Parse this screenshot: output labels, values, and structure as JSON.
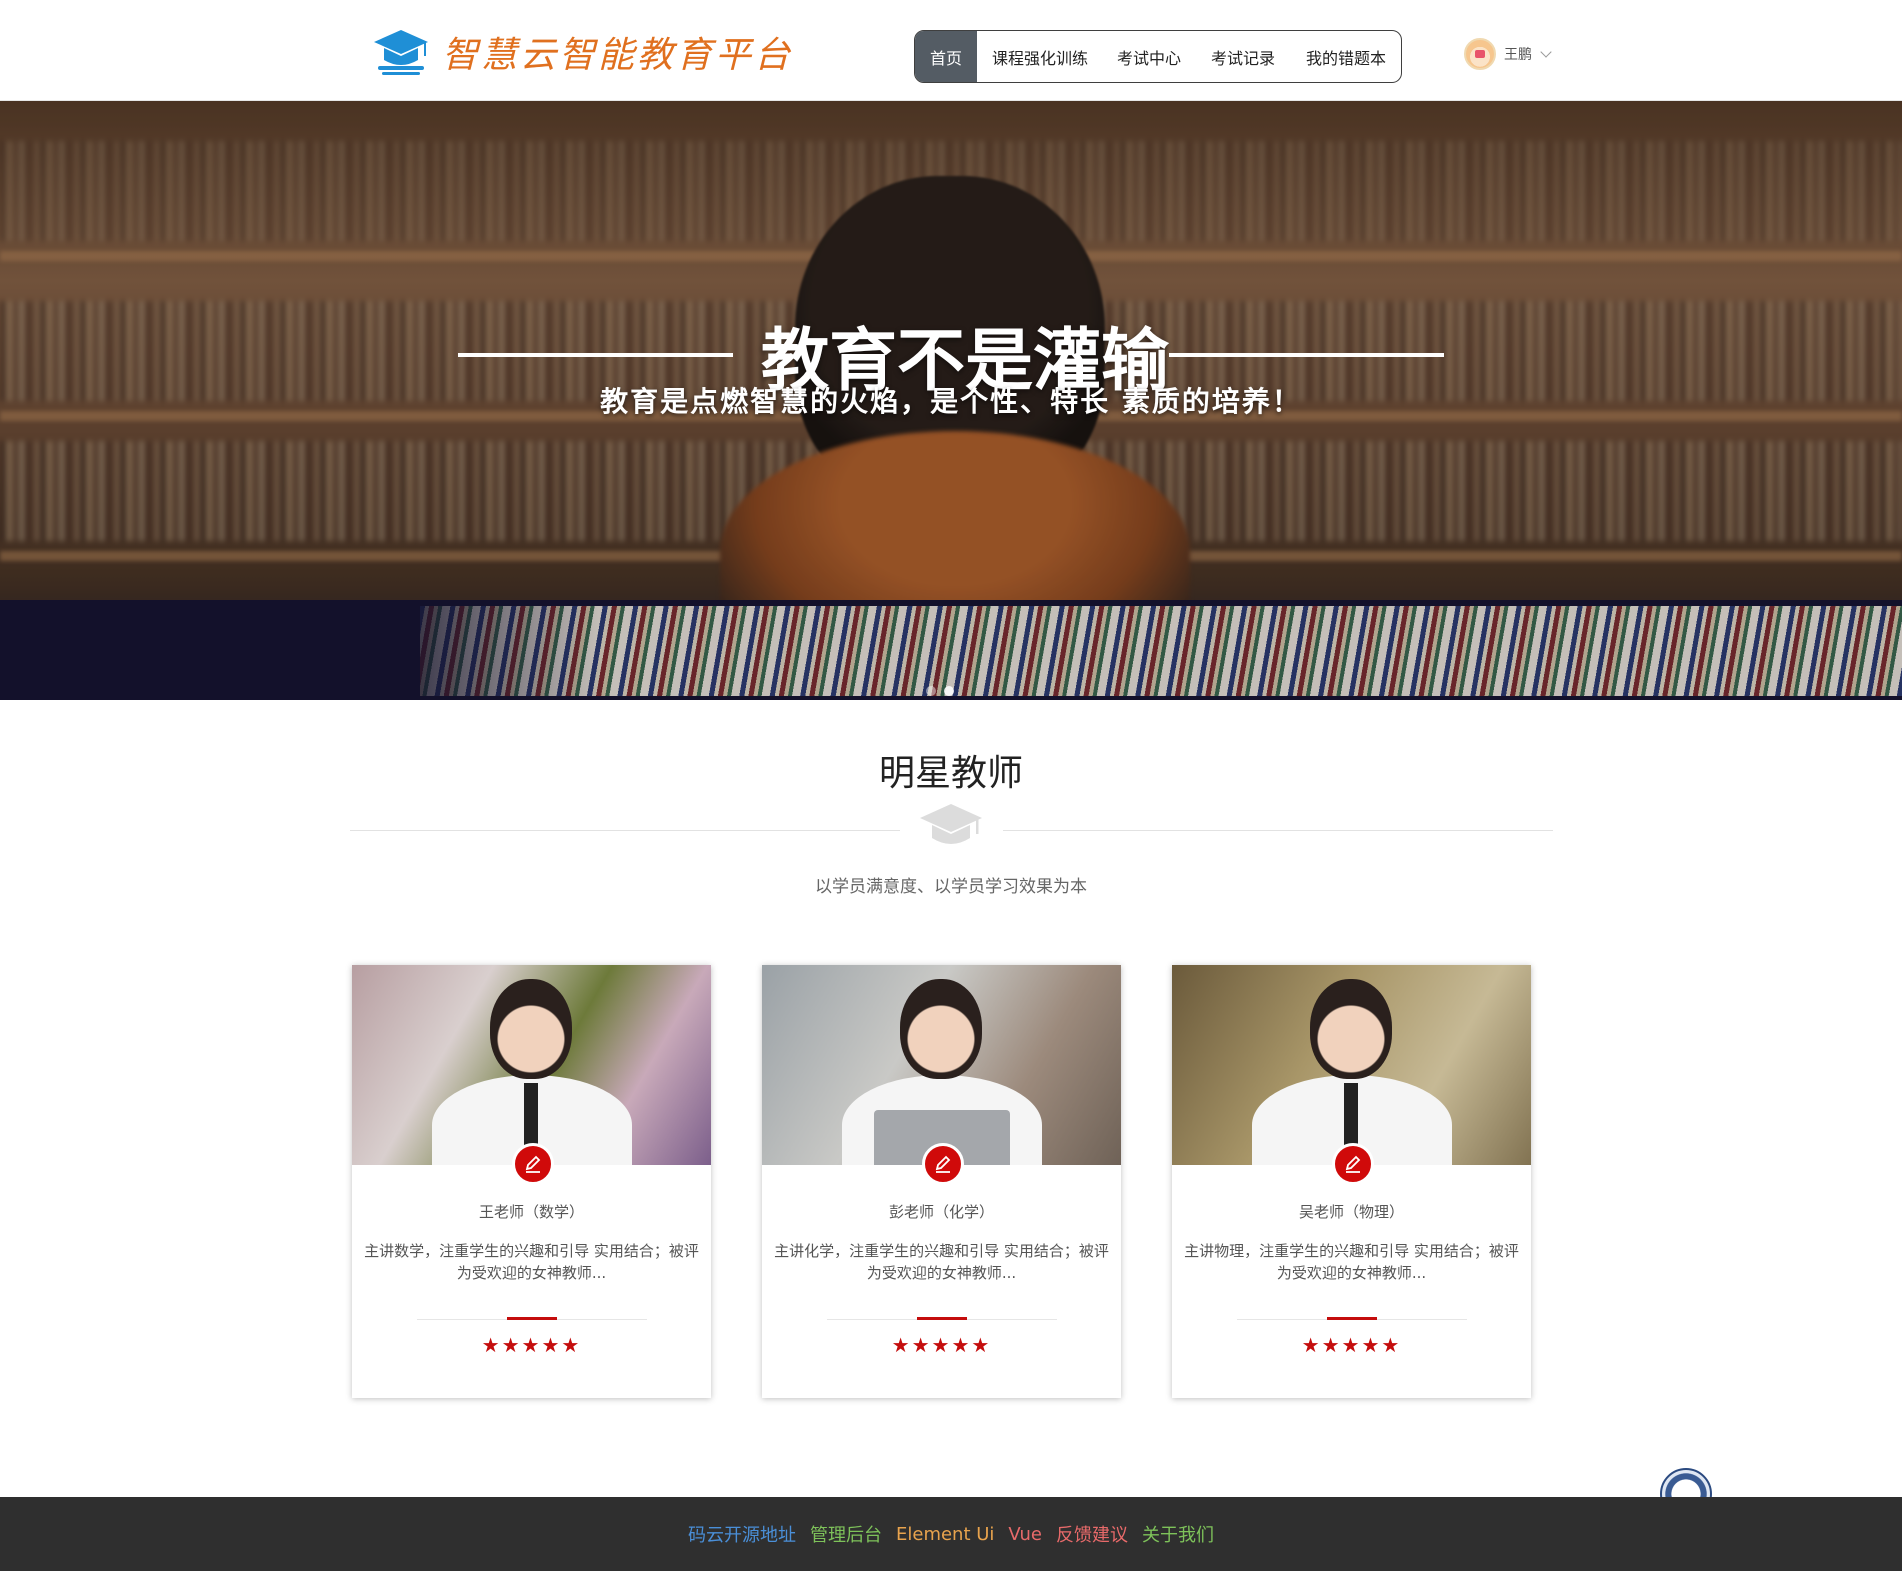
{
  "header": {
    "logo_text": "智慧云智能教育平台",
    "nav": [
      {
        "label": "首页",
        "active": true
      },
      {
        "label": "课程强化训练",
        "active": false
      },
      {
        "label": "考试中心",
        "active": false
      },
      {
        "label": "考试记录",
        "active": false
      },
      {
        "label": "我的错题本",
        "active": false
      }
    ],
    "user_name": "王鹏",
    "icons": {
      "logo": "graduation-cap-icon",
      "dropdown": "chevron-down-icon"
    }
  },
  "banner": {
    "title": "教育不是灌输",
    "subtitle": "教育是点燃智慧的火焰，是个性、特长  素质的培养！",
    "slides": 2,
    "active_slide": 1
  },
  "section": {
    "title": "明星教师",
    "subtitle": "以学员满意度、以学员学习效果为本"
  },
  "teachers": [
    {
      "name": "王老师（数学）",
      "desc_line1": "主讲数学，注重学生的兴趣和引导 实用结合；被评",
      "desc_line2": "为受欢迎的女神教师...",
      "stars": "★★★★★",
      "rating": 5
    },
    {
      "name": "彭老师（化学）",
      "desc_line1": "主讲化学，注重学生的兴趣和引导 实用结合；被评",
      "desc_line2": "为受欢迎的女神教师...",
      "stars": "★★★★★",
      "rating": 5
    },
    {
      "name": "吴老师（物理）",
      "desc_line1": "主讲物理，注重学生的兴趣和引导 实用结合；被评",
      "desc_line2": "为受欢迎的女神教师...",
      "stars": "★★★★★",
      "rating": 5
    }
  ],
  "footer": {
    "links": [
      {
        "label": "码云开源地址",
        "color": "#4a8fd8"
      },
      {
        "label": "管理后台",
        "color": "#7ec25a"
      },
      {
        "label": "Element Ui",
        "color": "#e8a34d"
      },
      {
        "label": "Vue",
        "color": "#e86a6a"
      },
      {
        "label": "反馈建议",
        "color": "#e86a6a"
      },
      {
        "label": "关于我们",
        "color": "#7ec25a"
      }
    ]
  },
  "colors": {
    "accent_red": "#c40d0d",
    "nav_active": "#545c64",
    "logo_orange": "#e0701f",
    "logo_blue": "#1f8fd6"
  }
}
